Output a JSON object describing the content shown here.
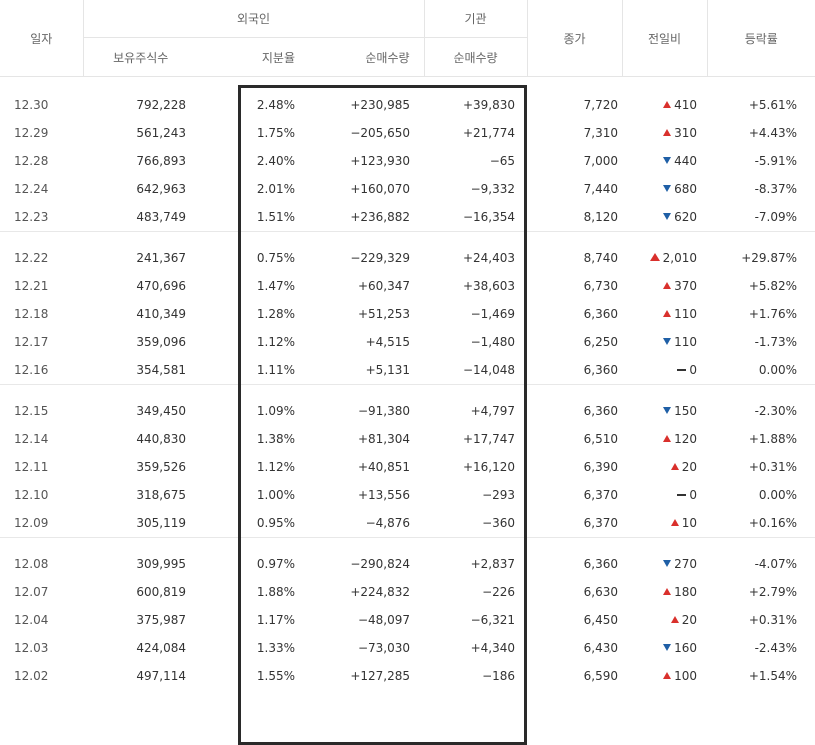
{
  "header": {
    "date": "일자",
    "foreign": "외국인",
    "institution": "기관",
    "holdings": "보유주식수",
    "ratio": "지분율",
    "foreign_net": "순매수량",
    "inst_net": "순매수량",
    "close": "종가",
    "change": "전일비",
    "rate": "등락률"
  },
  "groups": [
    [
      {
        "date": "12.30",
        "holdings": "792,228",
        "ratio": "2.48%",
        "fnet": "+230,985",
        "inet": "+39,830",
        "close": "7,720",
        "change": "410",
        "dir": "up",
        "rate": "+5.61%"
      },
      {
        "date": "12.29",
        "holdings": "561,243",
        "ratio": "1.75%",
        "fnet": "−205,650",
        "inet": "+21,774",
        "close": "7,310",
        "change": "310",
        "dir": "up",
        "rate": "+4.43%"
      },
      {
        "date": "12.28",
        "holdings": "766,893",
        "ratio": "2.40%",
        "fnet": "+123,930",
        "inet": "−65",
        "close": "7,000",
        "change": "440",
        "dir": "down",
        "rate": "-5.91%"
      },
      {
        "date": "12.24",
        "holdings": "642,963",
        "ratio": "2.01%",
        "fnet": "+160,070",
        "inet": "−9,332",
        "close": "7,440",
        "change": "680",
        "dir": "down",
        "rate": "-8.37%"
      },
      {
        "date": "12.23",
        "holdings": "483,749",
        "ratio": "1.51%",
        "fnet": "+236,882",
        "inet": "−16,354",
        "close": "8,120",
        "change": "620",
        "dir": "down",
        "rate": "-7.09%"
      }
    ],
    [
      {
        "date": "12.22",
        "holdings": "241,367",
        "ratio": "0.75%",
        "fnet": "−229,329",
        "inet": "+24,403",
        "close": "8,740",
        "change": "2,010",
        "dir": "limit",
        "rate": "+29.87%"
      },
      {
        "date": "12.21",
        "holdings": "470,696",
        "ratio": "1.47%",
        "fnet": "+60,347",
        "inet": "+38,603",
        "close": "6,730",
        "change": "370",
        "dir": "up",
        "rate": "+5.82%"
      },
      {
        "date": "12.18",
        "holdings": "410,349",
        "ratio": "1.28%",
        "fnet": "+51,253",
        "inet": "−1,469",
        "close": "6,360",
        "change": "110",
        "dir": "up",
        "rate": "+1.76%"
      },
      {
        "date": "12.17",
        "holdings": "359,096",
        "ratio": "1.12%",
        "fnet": "+4,515",
        "inet": "−1,480",
        "close": "6,250",
        "change": "110",
        "dir": "down",
        "rate": "-1.73%"
      },
      {
        "date": "12.16",
        "holdings": "354,581",
        "ratio": "1.11%",
        "fnet": "+5,131",
        "inet": "−14,048",
        "close": "6,360",
        "change": "0",
        "dir": "flat",
        "rate": "0.00%"
      }
    ],
    [
      {
        "date": "12.15",
        "holdings": "349,450",
        "ratio": "1.09%",
        "fnet": "−91,380",
        "inet": "+4,797",
        "close": "6,360",
        "change": "150",
        "dir": "down",
        "rate": "-2.30%"
      },
      {
        "date": "12.14",
        "holdings": "440,830",
        "ratio": "1.38%",
        "fnet": "+81,304",
        "inet": "+17,747",
        "close": "6,510",
        "change": "120",
        "dir": "up",
        "rate": "+1.88%"
      },
      {
        "date": "12.11",
        "holdings": "359,526",
        "ratio": "1.12%",
        "fnet": "+40,851",
        "inet": "+16,120",
        "close": "6,390",
        "change": "20",
        "dir": "up",
        "rate": "+0.31%"
      },
      {
        "date": "12.10",
        "holdings": "318,675",
        "ratio": "1.00%",
        "fnet": "+13,556",
        "inet": "−293",
        "close": "6,370",
        "change": "0",
        "dir": "flat",
        "rate": "0.00%"
      },
      {
        "date": "12.09",
        "holdings": "305,119",
        "ratio": "0.95%",
        "fnet": "−4,876",
        "inet": "−360",
        "close": "6,370",
        "change": "10",
        "dir": "up",
        "rate": "+0.16%"
      }
    ],
    [
      {
        "date": "12.08",
        "holdings": "309,995",
        "ratio": "0.97%",
        "fnet": "−290,824",
        "inet": "+2,837",
        "close": "6,360",
        "change": "270",
        "dir": "down",
        "rate": "-4.07%"
      },
      {
        "date": "12.07",
        "holdings": "600,819",
        "ratio": "1.88%",
        "fnet": "+224,832",
        "inet": "−226",
        "close": "6,630",
        "change": "180",
        "dir": "up",
        "rate": "+2.79%"
      },
      {
        "date": "12.04",
        "holdings": "375,987",
        "ratio": "1.17%",
        "fnet": "−48,097",
        "inet": "−6,321",
        "close": "6,450",
        "change": "20",
        "dir": "up",
        "rate": "+0.31%"
      },
      {
        "date": "12.03",
        "holdings": "424,084",
        "ratio": "1.33%",
        "fnet": "−73,030",
        "inet": "+4,340",
        "close": "6,430",
        "change": "160",
        "dir": "down",
        "rate": "-2.43%"
      },
      {
        "date": "12.02",
        "holdings": "497,114",
        "ratio": "1.55%",
        "fnet": "+127,285",
        "inet": "−186",
        "close": "6,590",
        "change": "100",
        "dir": "up",
        "rate": "+1.54%"
      }
    ]
  ]
}
